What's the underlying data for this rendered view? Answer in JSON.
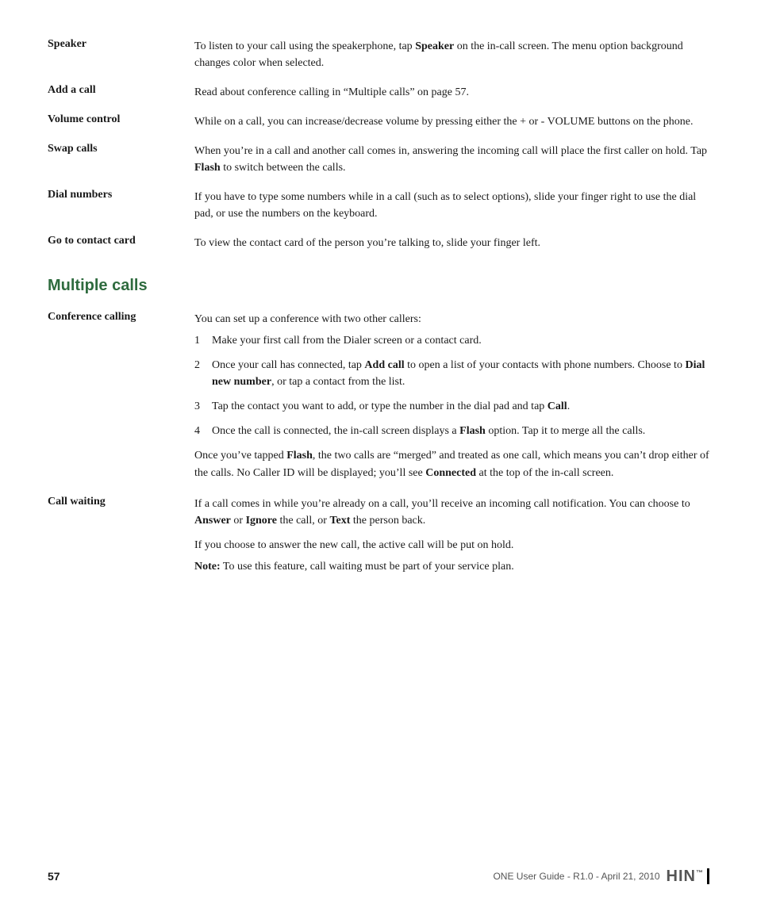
{
  "page": {
    "number": "57",
    "footer_info": "ONE User Guide - R1.0 - April 21, 2010"
  },
  "terms": [
    {
      "term": "Speaker",
      "definition_parts": [
        {
          "text": "To listen to your call using the speakerphone, tap "
        },
        {
          "text": "Speaker",
          "bold": true
        },
        {
          "text": " on the in-call screen. The menu option background changes color when selected."
        }
      ]
    },
    {
      "term": "Add a call",
      "definition": "Read about conference calling in “Multiple calls” on page 57."
    },
    {
      "term": "Volume control",
      "definition": "While on a call, you can increase/decrease volume by pressing either the + or - VOLUME buttons on the phone."
    },
    {
      "term": "Swap calls",
      "definition_parts": [
        {
          "text": "When you’re in a call and another call comes in, answering the incoming call will place the first caller on hold. Tap "
        },
        {
          "text": "Flash",
          "bold": true
        },
        {
          "text": " to switch between the calls."
        }
      ]
    },
    {
      "term": "Dial numbers",
      "definition": "If you have to type some numbers while in a call (such as to select options), slide your finger right to use the dial pad, or use the numbers on the keyboard."
    },
    {
      "term": "Go to contact card",
      "definition": "To view the contact card of the person you’re talking to, slide your finger left."
    }
  ],
  "section_heading": "Multiple calls",
  "conference": {
    "term": "Conference calling",
    "intro": "You can set up a conference with two other callers:",
    "steps": [
      {
        "num": "1",
        "text_parts": [
          {
            "text": "Make your first call from the Dialer screen or a contact card."
          }
        ]
      },
      {
        "num": "2",
        "text_parts": [
          {
            "text": "Once your call has connected, tap "
          },
          {
            "text": "Add call",
            "bold": true
          },
          {
            "text": " to open a list of your contacts with phone numbers. Choose to "
          },
          {
            "text": "Dial new number",
            "bold": true
          },
          {
            "text": ", or tap a contact from the list."
          }
        ]
      },
      {
        "num": "3",
        "text_parts": [
          {
            "text": "Tap the contact you want to add, or type the number in the dial pad and tap "
          },
          {
            "text": "Call",
            "bold": true
          },
          {
            "text": "."
          }
        ]
      },
      {
        "num": "4",
        "text_parts": [
          {
            "text": "Once the call is connected, the in-call screen displays a "
          },
          {
            "text": "Flash",
            "bold": true
          },
          {
            "text": " option. Tap it to merge all the calls."
          }
        ]
      }
    ],
    "extra_para_parts": [
      {
        "text": "Once you’ve tapped "
      },
      {
        "text": "Flash",
        "bold": true
      },
      {
        "text": ", the two calls are “merged” and treated as one call, which means you can’t drop either of the calls. No Caller ID will be displayed; you’ll see "
      },
      {
        "text": "Connected",
        "bold": true
      },
      {
        "text": " at the top of the in-call screen."
      }
    ]
  },
  "call_waiting": {
    "term": "Call waiting",
    "para1_parts": [
      {
        "text": "If a call comes in while you’re already on a call, you’ll receive an incoming call notification. You can choose to "
      },
      {
        "text": "Answer",
        "bold": true
      },
      {
        "text": " or "
      },
      {
        "text": "Ignore",
        "bold": true
      },
      {
        "text": " the call, or "
      },
      {
        "text": "Text",
        "bold": true
      },
      {
        "text": " the person back."
      }
    ],
    "para2": "If you choose to answer the new call, the active call will be put on hold.",
    "para3_parts": [
      {
        "text": "Note:",
        "bold": true
      },
      {
        "text": " To use this feature, call waiting must be part of your service plan."
      }
    ]
  }
}
